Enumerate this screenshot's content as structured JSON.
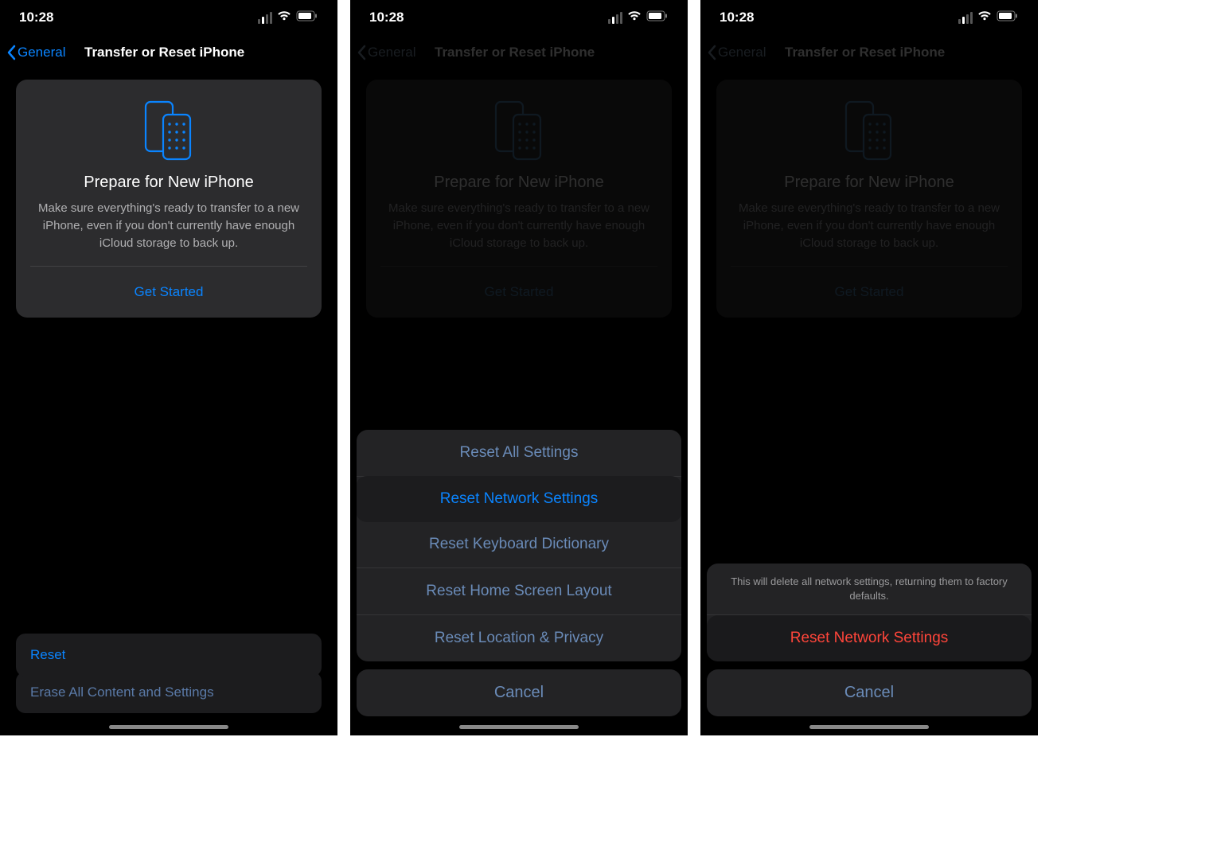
{
  "status": {
    "time": "10:28"
  },
  "nav": {
    "back_label": "General",
    "title": "Transfer or Reset iPhone"
  },
  "prepare": {
    "title": "Prepare for New iPhone",
    "body": "Make sure everything's ready to transfer to a new iPhone, even if you don't currently have enough iCloud storage to back up.",
    "cta": "Get Started"
  },
  "screen1": {
    "reset_label": "Reset",
    "erase_label": "Erase All Content and Settings"
  },
  "screen2": {
    "options": {
      "all": "Reset All Settings",
      "network": "Reset Network Settings",
      "keyboard": "Reset Keyboard Dictionary",
      "home": "Reset Home Screen Layout",
      "location": "Reset Location & Privacy"
    },
    "cancel": "Cancel"
  },
  "screen3": {
    "message": "This will delete all network settings, returning them to factory defaults.",
    "confirm": "Reset Network Settings",
    "cancel": "Cancel"
  }
}
